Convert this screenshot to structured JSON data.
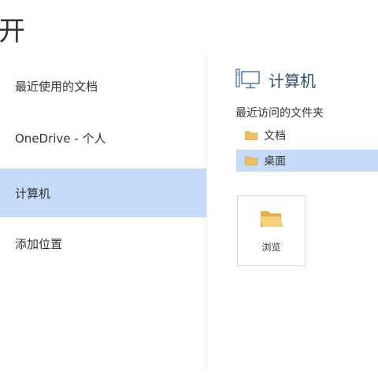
{
  "page": {
    "title": "开"
  },
  "places": [
    {
      "label": "最近使用的文档",
      "selected": false
    },
    {
      "label": "OneDrive - 个人",
      "selected": false
    },
    {
      "label": "计算机",
      "selected": true
    },
    {
      "label": "添加位置",
      "selected": false
    }
  ],
  "computer_section": {
    "icon": "computer-icon",
    "title": "计算机",
    "recent_folders_label": "最近访问的文件夹",
    "folders": [
      {
        "label": "文档",
        "icon": "folder-icon",
        "selected": false
      },
      {
        "label": "桌面",
        "icon": "folder-icon",
        "selected": true
      }
    ],
    "browse": {
      "label": "浏览",
      "icon": "open-folder-icon"
    }
  },
  "colors": {
    "selection": "#c5dbf7",
    "folder": "#f0c060",
    "title_text": "#2f4f70"
  }
}
